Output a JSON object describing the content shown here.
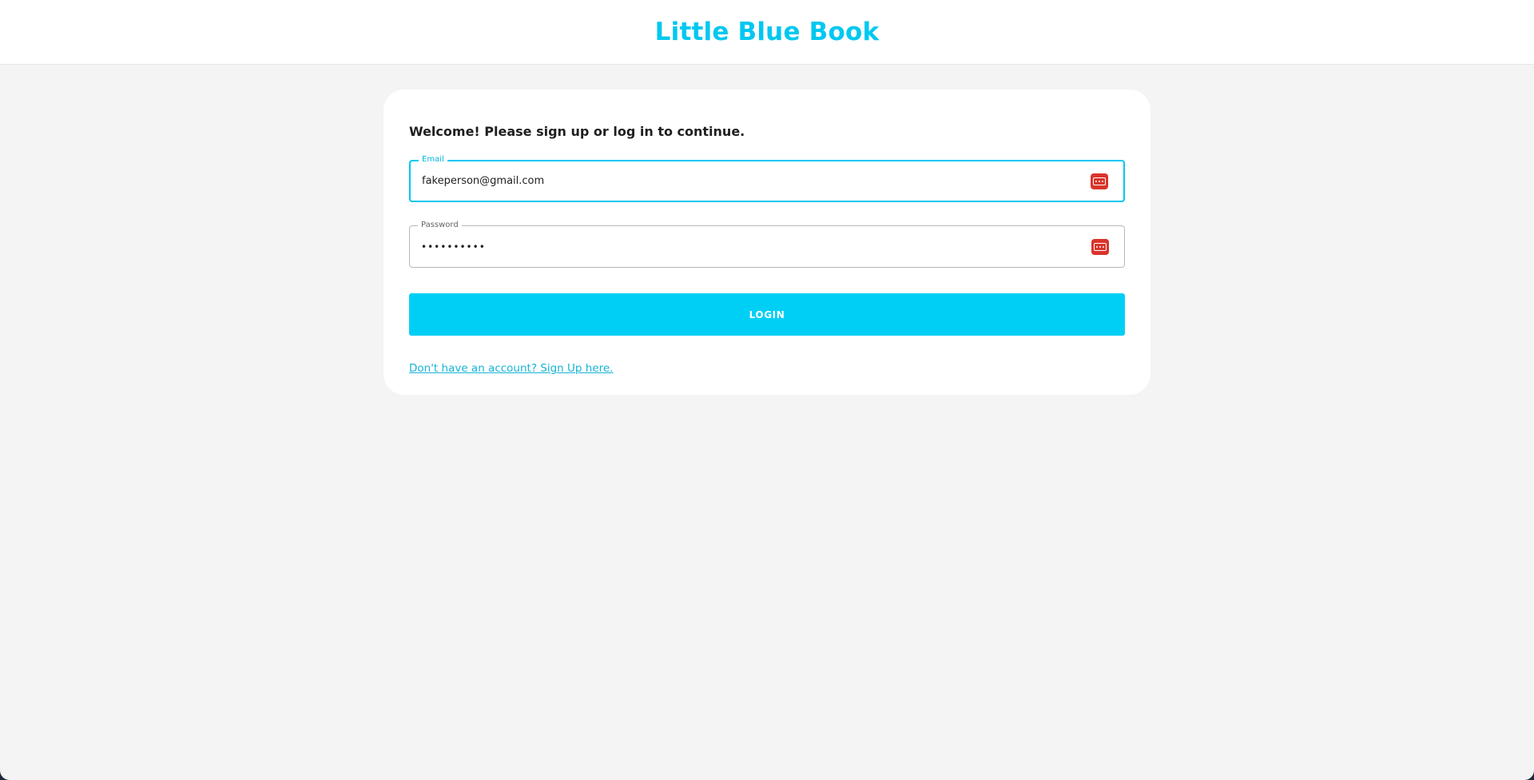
{
  "header": {
    "brand": "Little Blue Book"
  },
  "login_card": {
    "welcome_text": "Welcome! Please sign up or log in to continue.",
    "email": {
      "label": "Email",
      "value": "fakeperson@gmail.com",
      "icon": "password-manager-icon"
    },
    "password": {
      "label": "Password",
      "value": "••••••••••",
      "icon": "password-manager-icon"
    },
    "login_label": "LOGIN",
    "signup_link": "Don't have an account? Sign Up here."
  },
  "colors": {
    "brand": "#00c8f0",
    "button": "#00cff5",
    "link": "#16b4d6",
    "password_manager_icon": "#d9342b",
    "background": "#f4f4f4"
  }
}
